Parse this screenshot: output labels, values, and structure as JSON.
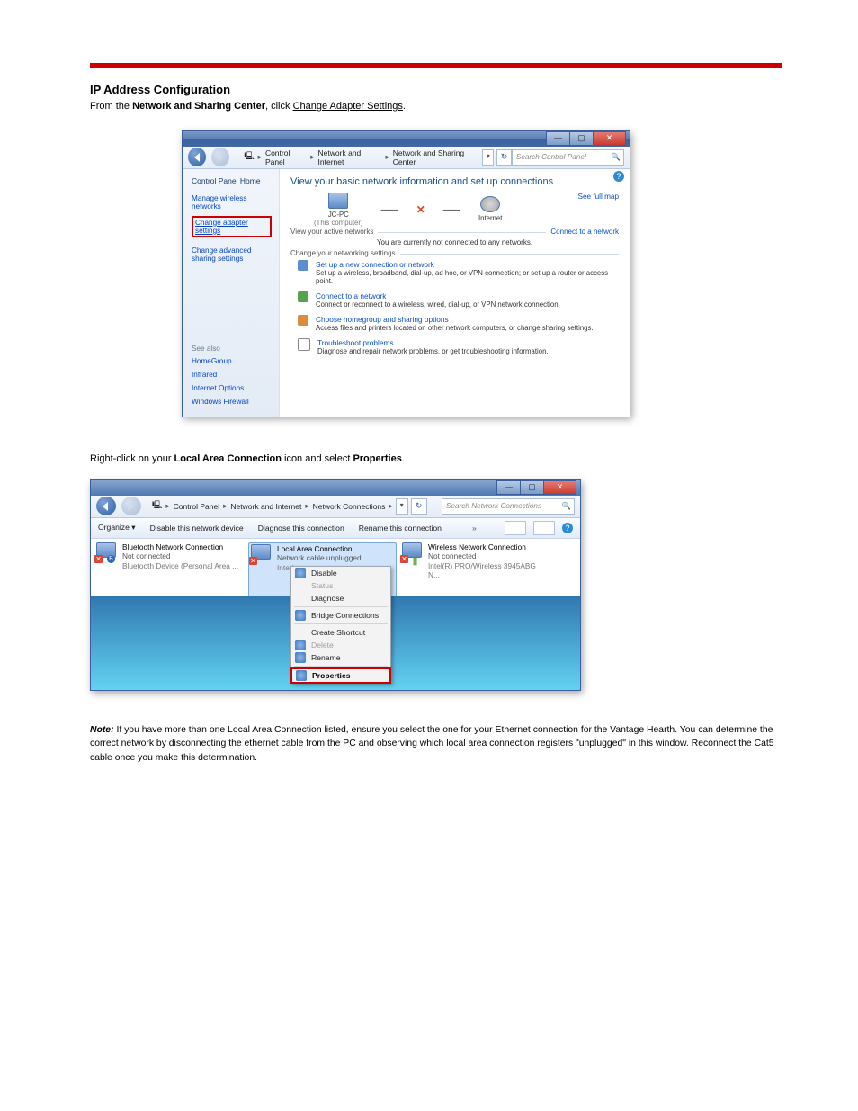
{
  "doc": {
    "section_title": "IP Address Configuration",
    "intro_before_bold": "From the ",
    "intro_bold": "Network and Sharing Center",
    "intro_after_bold": ", click ",
    "intro_link": "Change Adapter Settings",
    "intro_period": ".",
    "step2_prefix": "Right-click on your ",
    "step2_bold": "Local Area Connection",
    "step2_mid": " icon and select ",
    "step2_bold2": "Properties",
    "step2_suffix": ".",
    "note_label": "Note:",
    "note_text": " If you have more than one Local Area Connection listed, ensure you select the one for your Ethernet connection for the Vantage Hearth. You can determine the correct network by disconnecting the ethernet cable from the PC and observing which local area connection registers \"unplugged\" in this window. Reconnect the Cat5 cable once you make this determination."
  },
  "shot1": {
    "breadcrumb": {
      "b1": "Control Panel",
      "b2": "Network and Internet",
      "b3": "Network and Sharing Center"
    },
    "search_placeholder": "Search Control Panel",
    "left": {
      "home": "Control Panel Home",
      "manage": "Manage wireless networks",
      "change_adapter": "Change adapter settings",
      "change_advanced": "Change advanced sharing settings",
      "see_also": "See also",
      "homegroup": "HomeGroup",
      "infrared": "Infrared",
      "iopt": "Internet Options",
      "wfw": "Windows Firewall"
    },
    "main": {
      "headline": "View your basic network information and set up connections",
      "see_full": "See full map",
      "node_pc": "JC-PC",
      "node_pc_sub": "(This computer)",
      "node_net": "Internet",
      "active_label": "View your active networks",
      "connect_link": "Connect to a network",
      "not_connected": "You are currently not connected to any networks.",
      "change_label": "Change your networking settings",
      "a1t": "Set up a new connection or network",
      "a1d": "Set up a wireless, broadband, dial-up, ad hoc, or VPN connection; or set up a router or access point.",
      "a2t": "Connect to a network",
      "a2d": "Connect or reconnect to a wireless, wired, dial-up, or VPN network connection.",
      "a3t": "Choose homegroup and sharing options",
      "a3d": "Access files and printers located on other network computers, or change sharing settings.",
      "a4t": "Troubleshoot problems",
      "a4d": "Diagnose and repair network problems, or get troubleshooting information."
    }
  },
  "shot2": {
    "breadcrumb": {
      "b1": "Control Panel",
      "b2": "Network and Internet",
      "b3": "Network Connections"
    },
    "search_placeholder": "Search Network Connections",
    "cmd": {
      "organize": "Organize ▾",
      "disable": "Disable this network device",
      "diagnose": "Diagnose this connection",
      "rename": "Rename this connection",
      "more": "»"
    },
    "conn1": {
      "name": "Bluetooth Network Connection",
      "status": "Not connected",
      "adapter": "Bluetooth Device (Personal Area ..."
    },
    "conn2": {
      "name": "Local Area Connection",
      "status": "Network cable unplugged",
      "adapter": "Intel(..."
    },
    "conn3": {
      "name": "Wireless Network Connection",
      "status": "Not connected",
      "adapter": "Intel(R) PRO/Wireless 3945ABG N..."
    },
    "menu": {
      "disable": "Disable",
      "status": "Status",
      "diagnose": "Diagnose",
      "bridge": "Bridge Connections",
      "shortcut": "Create Shortcut",
      "delete": "Delete",
      "rename": "Rename",
      "properties": "Properties"
    }
  }
}
